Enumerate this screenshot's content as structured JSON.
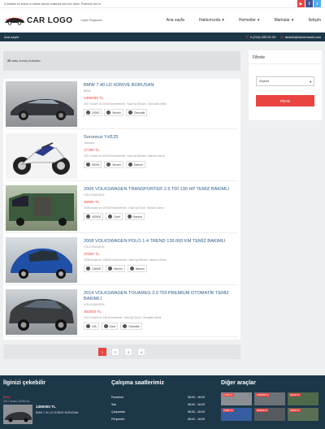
{
  "topbar": {
    "message": "Curabitur eu lectus in metus iaculis euismod sed nec diam. Praesent dui m",
    "social": [
      "youtube-icon",
      "facebook-icon",
      "twitter-icon"
    ]
  },
  "header": {
    "logo_text": "CAR LOGO",
    "slogan": "Sayfa Sloganıdır"
  },
  "nav": {
    "items": [
      {
        "label": "Ana sayfa"
      },
      {
        "label": "Hakkımızda",
        "caret": "▾"
      },
      {
        "label": "Hizmetler",
        "caret": "▾"
      },
      {
        "label": "Markalar",
        "caret": "▾"
      },
      {
        "label": "İletişim"
      }
    ]
  },
  "breadcrumb": {
    "label": "Ana sayfa",
    "phone": "0 (216) 000 00 00",
    "email": "destek@denemeadi.com"
  },
  "result": {
    "count": "20",
    "text": " araç sonuç bulundu."
  },
  "listings": [
    {
      "title": "BMW 7.40 LD XDRIVE BORUSAN",
      "brand": "BMW",
      "price": "1350000 TL",
      "desc": "2017 model ve 20000 kilometrede. Yakıt tipi Benzin. Otomatik vitesli.",
      "chips": [
        "20000",
        "Benzin",
        "Otomatik"
      ]
    },
    {
      "title": "Sorunsuz Yzf125",
      "brand": "Yamaha",
      "price": "17780 TL",
      "desc": "2017 model ve 50000 kilometrede. Yakıt tipi Benzin. Manuel vitesli.",
      "chips": [
        "50000",
        "Benzin",
        "Manuel"
      ]
    },
    {
      "title": "2006 VOLKSWAGEN TRANSPORTER 2.5 TDİ 130 HP TEMİZ BAKIMLI",
      "brand": "VOLKSWAGEN",
      "price": "46900 TL",
      "desc": "2006 model ve 400000 kilometrede. Yakıt tipi Dizel. Manuel vitesli.",
      "chips": [
        "400000",
        "Dizel",
        "Manuel"
      ]
    },
    {
      "title": "2008 VOLKSWAGEN POLO 1.4 TREND 136.000 KM TEMİZ BAKIMLI",
      "brand": "VOLKSWAGEN",
      "price": "37000 TL",
      "desc": "2008 model ve 136000 kilometrede. Yakıt tipi Benzin. Manuel vitesli.",
      "chips": [
        "136000",
        "Benzin",
        "Manuel"
      ]
    },
    {
      "title": "2014 VOLKSWAGEN TOUAREG 3.0 TDİ PREMIUM OTOMATİK TEMİZ BAKIMLI",
      "brand": "VOLKSWAGEN",
      "price": "303000 TL",
      "desc": "2014 model ve 245 kilometrede. Yakıt tipi Dizel. Otomatik vitesli.",
      "chips": [
        "245",
        "Dizel",
        "Otomatik"
      ]
    }
  ],
  "pagination": [
    "1",
    "2",
    "3",
    "4"
  ],
  "sidebar": {
    "title": "Filtrele",
    "select_value": "Seçiniz",
    "button": "Filtrele"
  },
  "footer": {
    "recent_title": "İlginizi çekebilir",
    "recent_brand": "BMW",
    "recent_sub": "2017 model, 20000 km",
    "recent_price": "1350000 TL",
    "recent_name": "BMW 7.40 LD XDRIVE BORUSAN",
    "hours_title": "Çalışma saatlerimiz",
    "hours": [
      {
        "day": "Pazartesi",
        "time": "08:00 - 18:00"
      },
      {
        "day": "Salı",
        "time": "08:00 - 18:00"
      },
      {
        "day": "Çarşamba",
        "time": "08:00 - 18:00"
      },
      {
        "day": "Perşembe",
        "time": "08:00 - 18:00"
      }
    ],
    "others_title": "Diğer araçlar",
    "others": [
      "17780 TL",
      "1350000 TL",
      "46900 TL",
      "37000 TL",
      "303000 TL",
      "46900 TL"
    ]
  },
  "colors": {
    "accent": "#e94440",
    "dark": "#1c3748",
    "link": "#2d5d8c"
  }
}
